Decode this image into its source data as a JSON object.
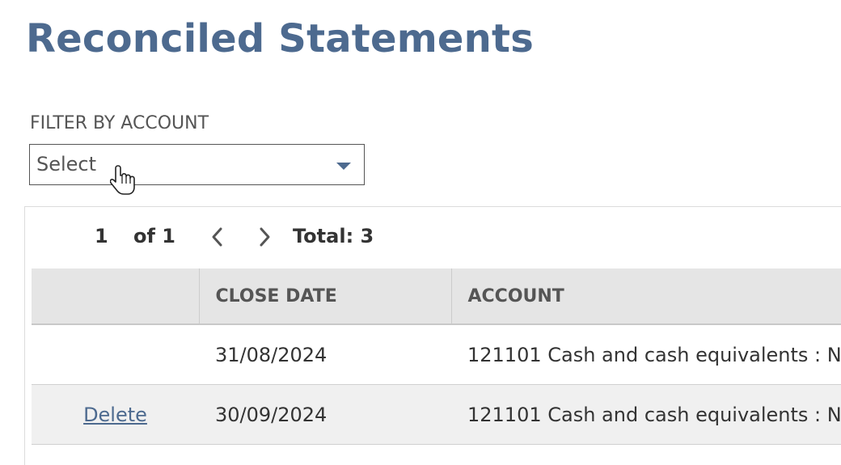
{
  "page": {
    "title": "Reconciled Statements"
  },
  "filter": {
    "label": "FILTER BY ACCOUNT",
    "selected": "Select"
  },
  "pager": {
    "current": "1",
    "of": "of 1",
    "total": "Total: 3"
  },
  "table": {
    "headers": [
      "",
      "CLOSE DATE",
      "ACCOUNT"
    ],
    "rows": [
      {
        "action": "",
        "close_date": "31/08/2024",
        "account": "121101 Cash and cash equivalents : N"
      },
      {
        "action": "Delete",
        "close_date": "30/09/2024",
        "account": "121101 Cash and cash equivalents : N"
      }
    ]
  },
  "colors": {
    "accent": "#4d6a8f",
    "header_bg": "#e5e5e5",
    "alt_row_bg": "#f0f0f0"
  },
  "icons": [
    "chevron-down-icon",
    "hand-pointer-icon",
    "chevron-left-icon",
    "chevron-right-icon"
  ]
}
